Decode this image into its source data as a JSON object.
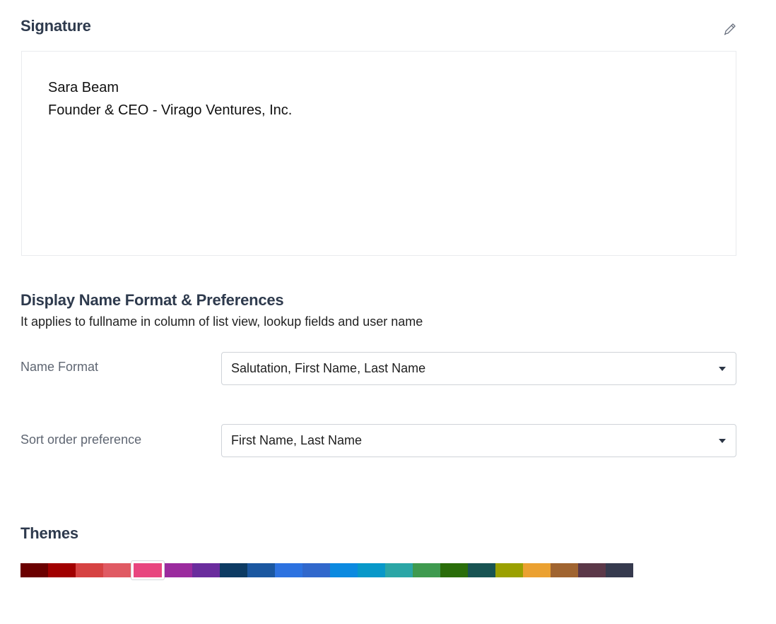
{
  "signature": {
    "title": "Signature",
    "edit_icon": "pencil-icon",
    "lines": [
      "Sara Beam",
      "Founder & CEO - Virago Ventures, Inc."
    ]
  },
  "display_name": {
    "title": "Display Name Format & Preferences",
    "subtitle": "It applies to fullname in column of list view, lookup fields and user name",
    "name_format": {
      "label": "Name Format",
      "value": "Salutation, First Name, Last Name"
    },
    "sort_order": {
      "label": "Sort order preference",
      "value": "First Name, Last Name"
    }
  },
  "themes": {
    "title": "Themes",
    "selected_index": 4,
    "colors": [
      "#6b0000",
      "#a10000",
      "#d64242",
      "#e05a63",
      "#e8467f",
      "#9b2b9e",
      "#6a2c9d",
      "#0d3b63",
      "#1b57a0",
      "#2d72e0",
      "#3168cc",
      "#0c8ae0",
      "#0898c9",
      "#2ba6a6",
      "#3f9a4f",
      "#2a6d0a",
      "#185352",
      "#9aa000",
      "#eba131",
      "#a06430",
      "#5b3848",
      "#363a4e"
    ]
  }
}
